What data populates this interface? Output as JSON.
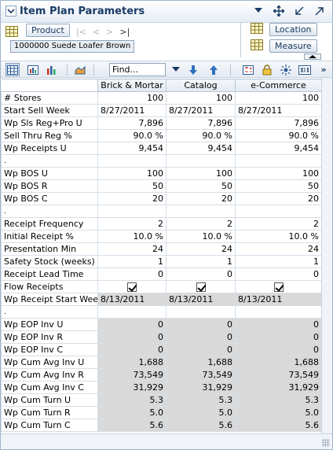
{
  "title": "Item Plan Parameters",
  "dimensions": {
    "product_label": "Product",
    "breadcrumb": "1000000 Suede Loafer Brown",
    "location_label": "Location",
    "measure_label": "Measure",
    "nav_first": "|<",
    "nav_prev": "<",
    "nav_next": ">",
    "nav_last": ">|"
  },
  "toolbar": {
    "find_placeholder": "Find...",
    "more": "»"
  },
  "columns": [
    "Brick & Mortar",
    "Catalog",
    "e-Commerce"
  ],
  "rows": [
    {
      "label": "# Stores",
      "values": [
        "100",
        "100",
        "100"
      ],
      "type": "num"
    },
    {
      "label": "Start Sell Week",
      "values": [
        "8/27/2011",
        "8/27/2011",
        "8/27/2011"
      ],
      "type": "date"
    },
    {
      "label": "Wp Sls Reg+Pro U",
      "values": [
        "7,896",
        "7,896",
        "7,896"
      ],
      "type": "num"
    },
    {
      "label": "Sell Thru Reg %",
      "values": [
        "90.0 %",
        "90.0 %",
        "90.0 %"
      ],
      "type": "num"
    },
    {
      "label": "Wp Receipts U",
      "values": [
        "9,454",
        "9,454",
        "9,454"
      ],
      "type": "num"
    },
    {
      "label": ".",
      "values": [
        "",
        "",
        ""
      ],
      "type": "dot"
    },
    {
      "label": "Wp BOS U",
      "values": [
        "100",
        "100",
        "100"
      ],
      "type": "num"
    },
    {
      "label": "Wp BOS R",
      "values": [
        "50",
        "50",
        "50"
      ],
      "type": "num"
    },
    {
      "label": "Wp BOS C",
      "values": [
        "20",
        "20",
        "20"
      ],
      "type": "num"
    },
    {
      "label": ".",
      "values": [
        "",
        "",
        ""
      ],
      "type": "dot"
    },
    {
      "label": "Receipt Frequency",
      "values": [
        "2",
        "2",
        "2"
      ],
      "type": "num"
    },
    {
      "label": "Initial Receipt %",
      "values": [
        "10.0 %",
        "10.0 %",
        "10.0 %"
      ],
      "type": "num"
    },
    {
      "label": "Presentation Min",
      "values": [
        "24",
        "24",
        "24"
      ],
      "type": "num"
    },
    {
      "label": "Safety Stock (weeks)",
      "values": [
        "1",
        "1",
        "1"
      ],
      "type": "num"
    },
    {
      "label": "Receipt Lead Time",
      "values": [
        "0",
        "0",
        "0"
      ],
      "type": "num"
    },
    {
      "label": "Flow Receipts",
      "values": [
        "checked",
        "checked",
        "checked"
      ],
      "type": "check"
    },
    {
      "label": "Wp Receipt Start Week",
      "values": [
        "8/13/2011",
        "8/13/2011",
        "8/13/2011"
      ],
      "type": "graydate"
    },
    {
      "label": ".",
      "values": [
        "",
        "",
        ""
      ],
      "type": "dot"
    },
    {
      "label": "Wp EOP Inv U",
      "values": [
        "0",
        "0",
        "0"
      ],
      "type": "gray"
    },
    {
      "label": "Wp EOP Inv R",
      "values": [
        "0",
        "0",
        "0"
      ],
      "type": "gray"
    },
    {
      "label": "Wp EOP Inv C",
      "values": [
        "0",
        "0",
        "0"
      ],
      "type": "gray"
    },
    {
      "label": "Wp Cum Avg Inv U",
      "values": [
        "1,688",
        "1,688",
        "1,688"
      ],
      "type": "gray"
    },
    {
      "label": "Wp Cum Avg Inv R",
      "values": [
        "73,549",
        "73,549",
        "73,549"
      ],
      "type": "gray"
    },
    {
      "label": "Wp Cum Avg Inv C",
      "values": [
        "31,929",
        "31,929",
        "31,929"
      ],
      "type": "gray"
    },
    {
      "label": "Wp Cum Turn U",
      "values": [
        "5.3",
        "5.3",
        "5.3"
      ],
      "type": "gray"
    },
    {
      "label": "Wp Cum Turn R",
      "values": [
        "5.0",
        "5.0",
        "5.0"
      ],
      "type": "gray"
    },
    {
      "label": "Wp Cum Turn C",
      "values": [
        "5.6",
        "5.6",
        "5.6"
      ],
      "type": "gray"
    }
  ]
}
